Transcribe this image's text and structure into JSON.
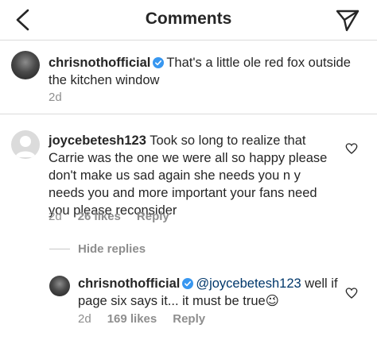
{
  "header": {
    "title": "Comments"
  },
  "caption": {
    "username": "chrisnothofficial",
    "text": "That's a little ole red fox outside the kitchen window",
    "time": "2d"
  },
  "comment": {
    "username": "joycebetesh123",
    "text": "Took so long to realize that Carrie was the one we were all so happy please don't make us sad again she needs you n y needs you and more important your fans need you please reconsider",
    "time": "2d",
    "likes": "26 likes",
    "reply_label": "Reply"
  },
  "hide_replies_label": "Hide replies",
  "reply": {
    "username": "chrisnothofficial",
    "mention": "@joycebetesh123",
    "text": "well if page six says it... it must be true😉",
    "time": "2d",
    "likes": "169 likes",
    "reply_label": "Reply"
  }
}
